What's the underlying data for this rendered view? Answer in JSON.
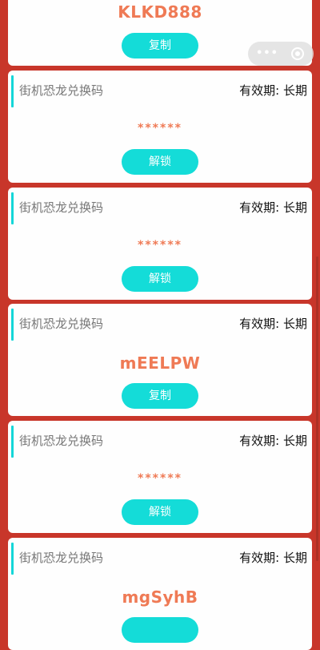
{
  "cards": [
    {
      "title": "",
      "validity": "",
      "code": "KLKD888",
      "button": "复制"
    },
    {
      "title": "街机恐龙兑换码",
      "validity": "有效期: 长期",
      "code": "******",
      "button": "解锁"
    },
    {
      "title": "街机恐龙兑换码",
      "validity": "有效期: 长期",
      "code": "******",
      "button": "解锁"
    },
    {
      "title": "街机恐龙兑换码",
      "validity": "有效期: 长期",
      "code": "mEELPW",
      "button": "复制"
    },
    {
      "title": "街机恐龙兑换码",
      "validity": "有效期: 长期",
      "code": "******",
      "button": "解锁"
    },
    {
      "title": "街机恐龙兑换码",
      "validity": "有效期: 长期",
      "code": "mgSyhB",
      "button": ""
    }
  ],
  "capsule": {
    "menu_icon": "more-dots-icon",
    "close_icon": "target-close-icon"
  },
  "colors": {
    "background": "#c8362a",
    "card": "#fefefe",
    "accent": "#14d6d8",
    "button": "#14dcd8",
    "code": "#ef7a55"
  }
}
